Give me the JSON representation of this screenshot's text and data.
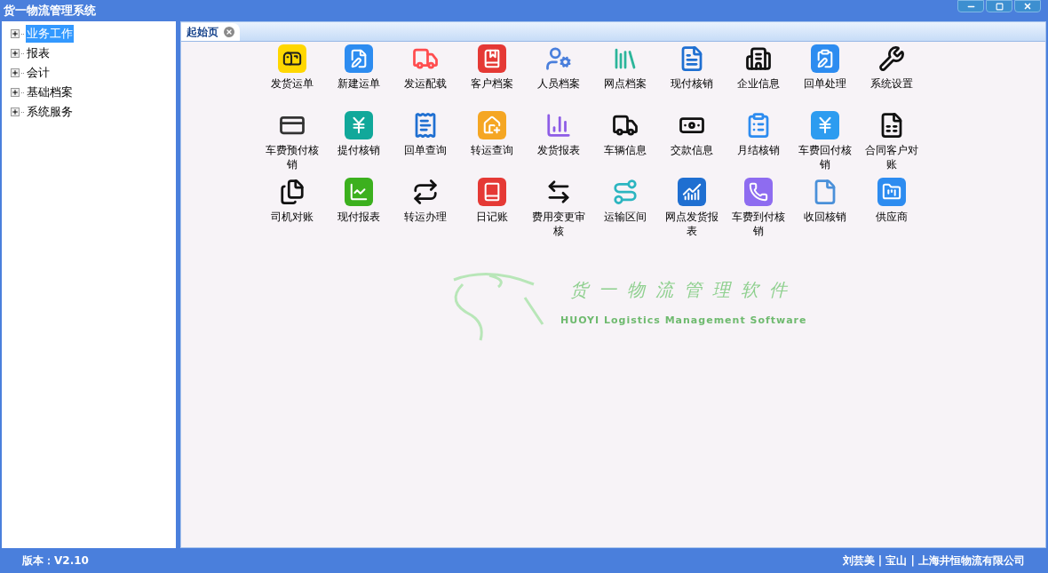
{
  "window": {
    "title": "货一物流管理系统"
  },
  "sidebar": {
    "items": [
      {
        "label": "业务工作",
        "selected": true,
        "expanded": false
      },
      {
        "label": "报表",
        "selected": false,
        "expanded": false
      },
      {
        "label": "会计",
        "selected": false,
        "expanded": false
      },
      {
        "label": "基础档案",
        "selected": false,
        "expanded": false
      },
      {
        "label": "系统服务",
        "selected": false,
        "expanded": false
      }
    ]
  },
  "tabs": [
    {
      "label": "起始页",
      "selected": true
    }
  ],
  "launcher": {
    "items": [
      "发货运单",
      "新建运单",
      "发运配载",
      "客户档案",
      "人员档案",
      "网点档案",
      "现付核销",
      "企业信息",
      "回单处理",
      "系统设置",
      "车费预付核销",
      "提付核销",
      "回单查询",
      "转运查询",
      "发货报表",
      "车辆信息",
      "交款信息",
      "月结核销",
      "车费回付核销",
      "合同客户对账",
      "司机对账",
      "现付报表",
      "转运办理",
      "日记账",
      "费用变更审核",
      "运输区间",
      "网点发货报表",
      "车费到付核销",
      "收回核销",
      "供应商"
    ]
  },
  "logo": {
    "title": "货一物流管理软件",
    "subtitle": "HUOYI Logistics Management Software"
  },
  "status_bar": {
    "version": "版本：V2.10",
    "user_info": "刘芸美 | 宝山 | 上海井恒物流有限公司"
  }
}
